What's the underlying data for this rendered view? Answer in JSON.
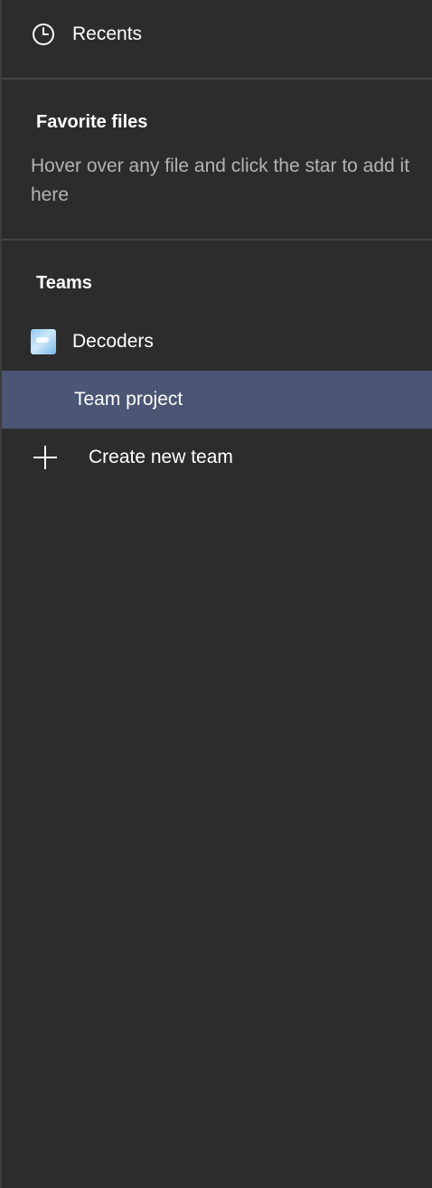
{
  "nav": {
    "recents_label": "Recents",
    "recents_icon": "clock-icon"
  },
  "favorites": {
    "title": "Favorite files",
    "hint": "Hover over any file and click the star to add it here"
  },
  "teams": {
    "title": "Teams",
    "items": [
      {
        "label": "Decoders",
        "icon": "team-avatar"
      }
    ],
    "projects": [
      {
        "label": "Team project",
        "selected": true
      }
    ],
    "create_label": "Create new team",
    "create_icon": "plus-icon"
  },
  "colors": {
    "background": "#2c2c2c",
    "selected_row": "#4b5675",
    "divider": "#444444",
    "hint_text": "#b3b3b3"
  }
}
